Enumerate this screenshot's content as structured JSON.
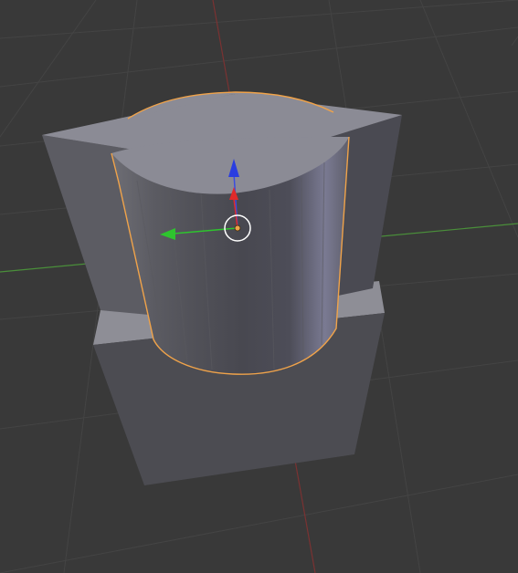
{
  "viewport": {
    "name": "3D Viewport",
    "background": "#393939",
    "grid_color": "#444444",
    "x_axis_color": "#9a3b3b",
    "y_axis_color": "#4a8f3a"
  },
  "scene": {
    "objects": [
      "cube-base",
      "cube-top",
      "cylinder-selected"
    ],
    "selected_object": "cylinder-selected",
    "selection_outline_color": "#f0a34a"
  },
  "gizmo": {
    "x_axis_color": "#e02a2a",
    "y_axis_color": "#2ec42e",
    "z_axis_color": "#2a3de0",
    "origin_color": "#f0a34a",
    "center_ring_color": "#ffffff"
  }
}
